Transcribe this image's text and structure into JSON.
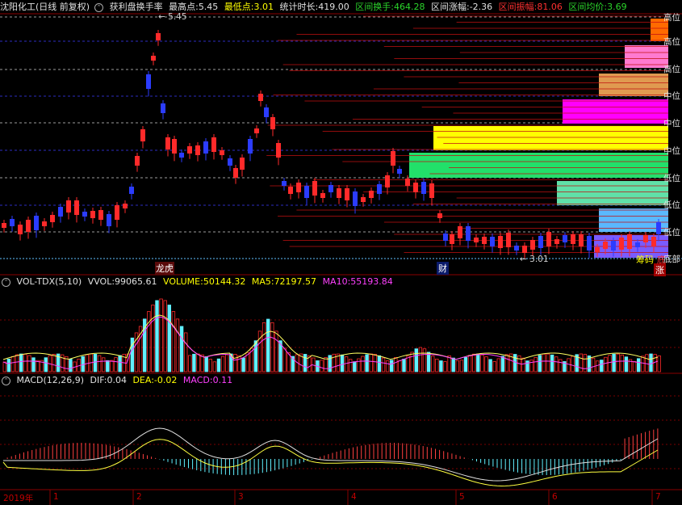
{
  "title_bar": {
    "stock": "沈阳化工(日线 前复权)",
    "indicator": "获利盘换手率",
    "high_label": "最高点:",
    "high_value": "5.45",
    "low_label": "最低点:",
    "low_value": "3.01",
    "span_label": "统计时长:",
    "span_value": "419.00",
    "turnover_label": "区间换手:",
    "turnover_value": "464.28",
    "change_label": "区间涨幅:",
    "change_value": "-2.36",
    "amplitude_label": "区间振幅:",
    "amplitude_value": "81.06",
    "avg_label": "区间均价:",
    "avg_value": "3.69"
  },
  "main_chart": {
    "high_marker": "5.45",
    "low_marker": "3.01",
    "tag_board": "龙虎",
    "tag_finance": "财",
    "tag_chip": "筹码",
    "tag_rise": "涨",
    "tag_bottom": "底",
    "level_labels": [
      "高位",
      "高位",
      "高位",
      "中位",
      "中位",
      "中位",
      "低位",
      "低位",
      "低位",
      "底部"
    ],
    "colors": {
      "up": "#ff2a2a",
      "down": "#2b3cff",
      "grid": "#7a0000"
    }
  },
  "volume_panel": {
    "name": "VOL-TDX(5,10)",
    "vvol_label": "VVOL:",
    "vvol_value": "99065.61",
    "volume_label": "VOLUME:",
    "volume_value": "50144.32",
    "ma5_label": "MA5:",
    "ma5_value": "72197.57",
    "ma10_label": "MA10:",
    "ma10_value": "55193.84"
  },
  "macd_panel": {
    "name": "MACD(12,26,9)",
    "dif_label": "DIF:",
    "dif_value": "0.04",
    "dea_label": "DEA:",
    "dea_value": "-0.02",
    "macd_label": "MACD:",
    "macd_value": "0.11"
  },
  "date_axis": [
    "2019年",
    "1",
    "2",
    "3",
    "4",
    "5",
    "6",
    "7"
  ]
}
